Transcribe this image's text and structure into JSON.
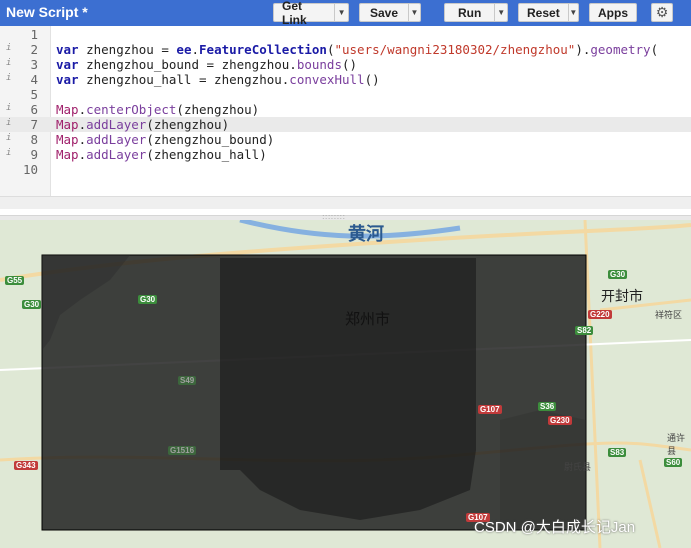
{
  "toolbar": {
    "title": "New Script *",
    "get_link": "Get Link",
    "save": "Save",
    "run": "Run",
    "reset": "Reset",
    "apps": "Apps",
    "dropdown_icon": "▼",
    "gear_icon": "⚙"
  },
  "editor": {
    "line_numbers": [
      "1",
      "2",
      "3",
      "4",
      "5",
      "6",
      "7",
      "8",
      "9",
      "10"
    ],
    "highlighted_line": 7
  },
  "splitter": {
    "grip": "::::::::"
  },
  "map": {
    "river_label": "黄河",
    "city_zhengzhou": "郑州市",
    "city_kaifeng": "开封市",
    "label_xiangfu": "祥符区",
    "label_weishi": "尉氏县",
    "label_tongxu": "通许县",
    "highways": [
      "G55",
      "G30",
      "G30",
      "G30",
      "G220",
      "S82",
      "S36",
      "G230",
      "S83",
      "G343",
      "S60",
      "G107",
      "G107",
      "S49",
      "G1516"
    ],
    "overlay_color": "#1a1a1a",
    "watermark": "CSDN @大白成长记Jan"
  }
}
